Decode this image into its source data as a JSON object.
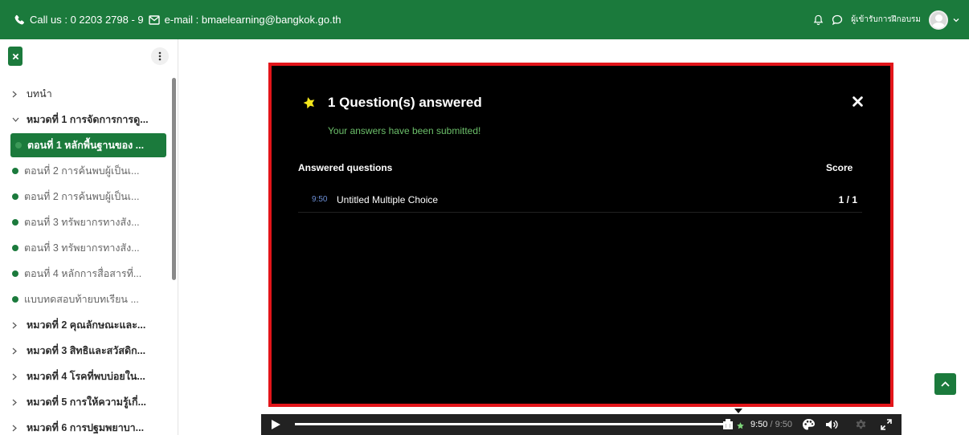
{
  "topbar": {
    "phone_text": "Call us : 0 2203 2798 - 9",
    "email_text": "e-mail : bmaelearning@bangkok.go.th",
    "user_role": "ผู้เข้ารับการฝึกอบรม"
  },
  "sidebar": {
    "items": [
      {
        "label": "บทนำ",
        "kind": "section",
        "expanded": false
      },
      {
        "label": "หมวดที่ 1 การจัดการการดู...",
        "kind": "section",
        "expanded": true
      },
      {
        "label": "ตอนที่ 1 หลักพื้นฐานของ ...",
        "kind": "lesson",
        "active": true
      },
      {
        "label": "ตอนที่ 2 การค้นพบผู้เป็นเ...",
        "kind": "lesson"
      },
      {
        "label": "ตอนที่ 2 การค้นพบผู้เป็นเ...",
        "kind": "lesson"
      },
      {
        "label": "ตอนที่ 3 ทรัพยากรทางสัง...",
        "kind": "lesson"
      },
      {
        "label": "ตอนที่ 3 ทรัพยากรทางสัง...",
        "kind": "lesson"
      },
      {
        "label": "ตอนที่ 4 หลักการสื่อสารที่...",
        "kind": "lesson"
      },
      {
        "label": "แบบทดสอบท้ายบทเรียน ...",
        "kind": "lesson"
      },
      {
        "label": "หมวดที่ 2 คุณลักษณะและ...",
        "kind": "section",
        "expanded": false
      },
      {
        "label": "หมวดที่ 3 สิทธิและสวัสดิก...",
        "kind": "section",
        "expanded": false
      },
      {
        "label": "หมวดที่ 4 โรคที่พบบ่อยใน...",
        "kind": "section",
        "expanded": false
      },
      {
        "label": "หมวดที่ 5 การให้ความรู้เกี่...",
        "kind": "section",
        "expanded": false
      },
      {
        "label": "หมวดที่ 6 การปฐมพยาบา...",
        "kind": "section",
        "expanded": false
      }
    ]
  },
  "player": {
    "title": "1 Question(s) answered",
    "submitted_message": "Your answers have been submitted!",
    "col_questions": "Answered questions",
    "col_score": "Score",
    "rows": [
      {
        "time": "9:50",
        "name": "Untitled Multiple Choice",
        "score": "1 / 1"
      }
    ],
    "current_time": "9:50",
    "duration": " / 9:50",
    "progress": 1.0
  },
  "colors": {
    "brand_green": "#1b7a3c",
    "player_border": "#e3151a",
    "success_text": "#6cbf6a"
  },
  "icons": [
    "phone-icon",
    "mail-icon",
    "bell-icon",
    "chat-icon",
    "avatar",
    "chevron-down-icon",
    "close-icon",
    "kebab-icon",
    "chevron-right-icon",
    "star-icon",
    "play-icon",
    "palette-icon",
    "volume-icon",
    "gear-icon",
    "fullscreen-icon",
    "chevron-up-icon"
  ]
}
